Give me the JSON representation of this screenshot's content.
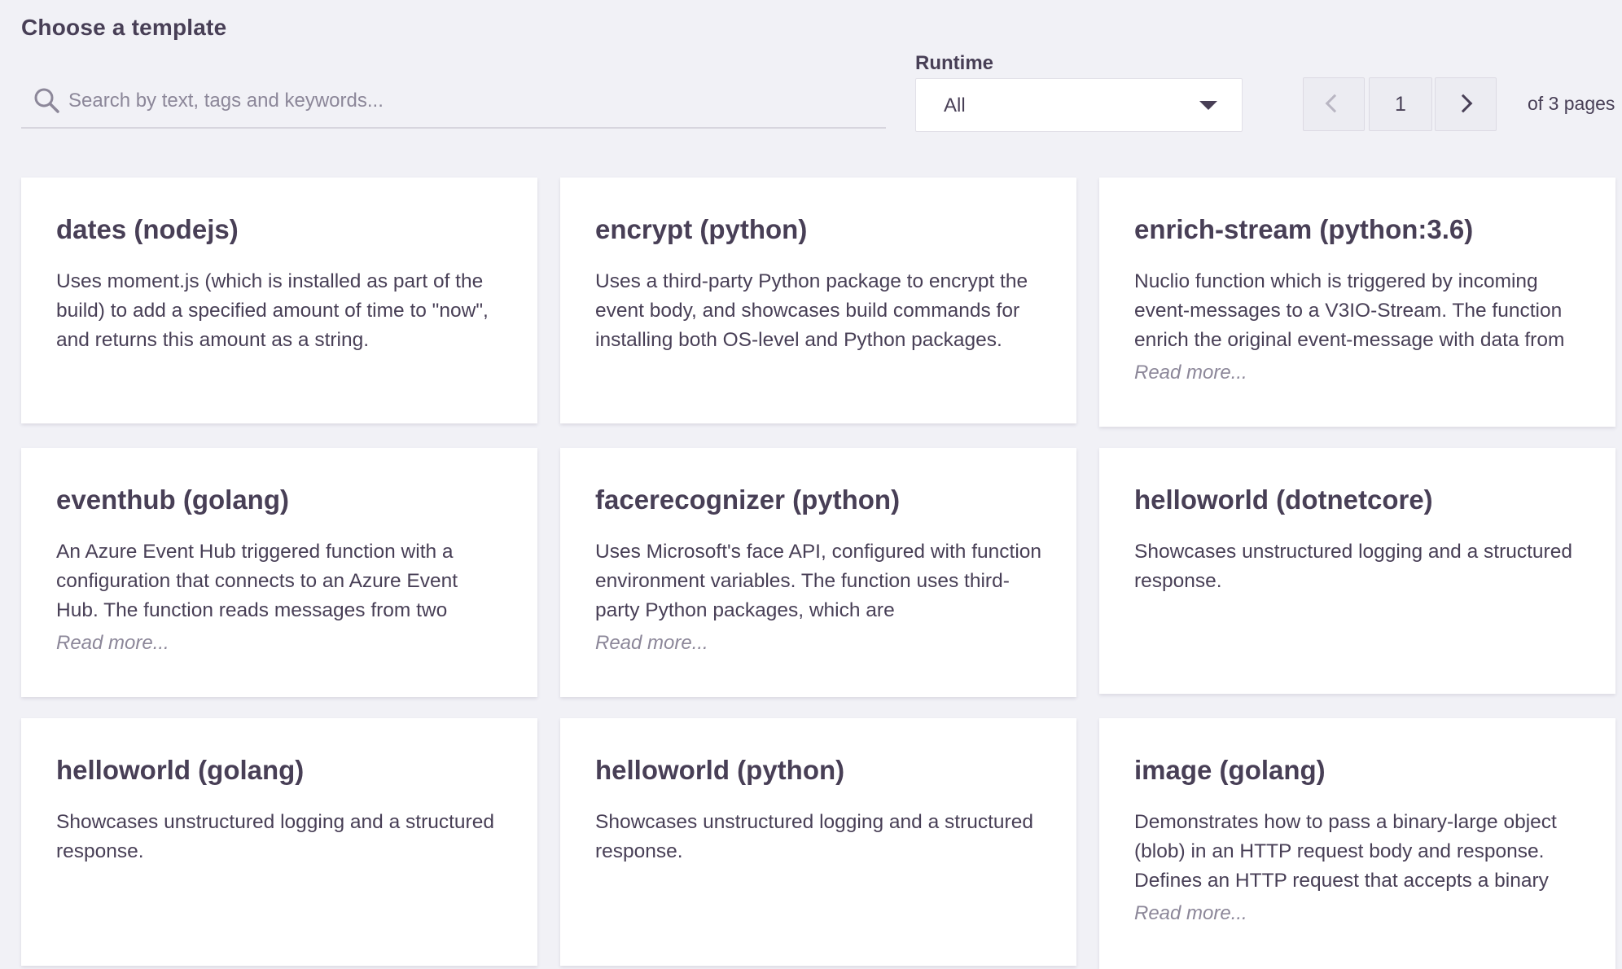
{
  "header": {
    "title": "Choose a template"
  },
  "search": {
    "placeholder": "Search by text, tags and keywords..."
  },
  "runtime": {
    "label": "Runtime",
    "selected": "All"
  },
  "pagination": {
    "current_page": "1",
    "total_label": "of 3 pages"
  },
  "read_more_label": "Read more...",
  "templates": [
    {
      "title": "dates (nodejs)",
      "description": "Uses moment.js (which is installed as part of the build) to add a specified amount of time to \"now\", and returns this amount as a string.",
      "read_more": ""
    },
    {
      "title": "encrypt (python)",
      "description": "Uses a third-party Python package to encrypt the event body, and showcases build commands for installing both OS-level and Python packages.",
      "read_more": ""
    },
    {
      "title": "enrich-stream (python:3.6)",
      "description": "Nuclio function which is triggered by incoming event-messages to a V3IO-Stream. The function enrich the original event-message with data from",
      "read_more": "Read more..."
    },
    {
      "title": "eventhub (golang)",
      "description": "An Azure Event Hub triggered function with a configuration that connects to an Azure Event Hub. The function reads messages from two",
      "read_more": "Read more..."
    },
    {
      "title": "facerecognizer (python)",
      "description": "Uses Microsoft's face API, configured with function environment variables. The function uses third-party Python packages, which are",
      "read_more": "Read more..."
    },
    {
      "title": "helloworld (dotnetcore)",
      "description": "Showcases unstructured logging and a structured response.",
      "read_more": ""
    },
    {
      "title": "helloworld (golang)",
      "description": "Showcases unstructured logging and a structured response.",
      "read_more": ""
    },
    {
      "title": "helloworld (python)",
      "description": "Showcases unstructured logging and a structured response.",
      "read_more": ""
    },
    {
      "title": "image (golang)",
      "description": "Demonstrates how to pass a binary-large object (blob) in an HTTP request body and response. Defines an HTTP request that accepts a binary",
      "read_more": "Read more..."
    }
  ]
}
